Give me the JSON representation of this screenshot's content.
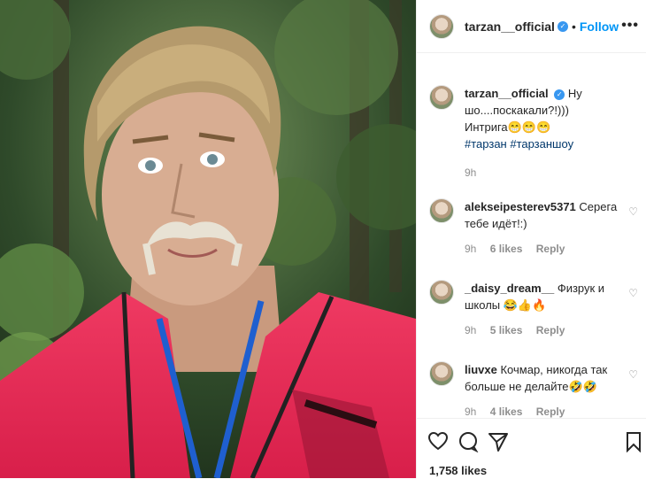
{
  "post": {
    "username": "tarzan__official",
    "follow_label": "Follow",
    "dot": "•",
    "more": "•••",
    "verified_icon": "✓"
  },
  "caption": {
    "username": "tarzan__official",
    "line1": "Ну",
    "line2": "шо....поскакали?!)))",
    "line3": "Интрига😁😁😁",
    "hashtags": "#тарзан #тарзаншоу",
    "time": "9h"
  },
  "comments": [
    {
      "username": "alekseipesterev5371",
      "text": "Серега тебе идёт!:)",
      "time": "9h",
      "likes": "6 likes",
      "reply": "Reply"
    },
    {
      "username": "_daisy_dream__",
      "text": "Физрук и школы 😂👍🔥",
      "time": "9h",
      "likes": "5 likes",
      "reply": "Reply"
    },
    {
      "username": "liuvxe",
      "text": "Кочмар, никогда так больше не делайте🤣🤣",
      "time": "9h",
      "likes": "4 likes",
      "reply": "Reply"
    }
  ],
  "footer": {
    "likes": "1,758 likes"
  },
  "colors": {
    "accent": "#0095f6",
    "hashtag": "#00376b",
    "muted": "#8e8e8e"
  }
}
